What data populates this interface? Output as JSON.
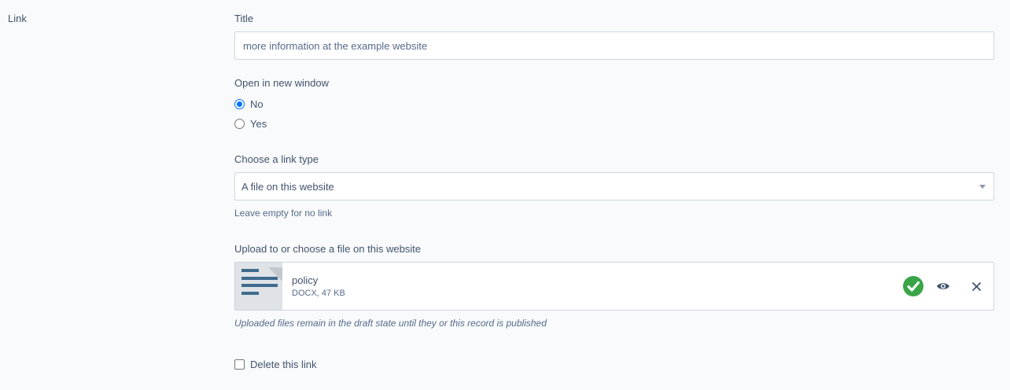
{
  "section": {
    "label": "Link"
  },
  "title_field": {
    "label": "Title",
    "value": "more information at the example website"
  },
  "new_window": {
    "label": "Open in new window",
    "options": [
      {
        "label": "No",
        "checked": true
      },
      {
        "label": "Yes",
        "checked": false
      }
    ]
  },
  "link_type": {
    "label": "Choose a link type",
    "selected": "A file on this website",
    "help": "Leave empty for no link"
  },
  "upload": {
    "label": "Upload to or choose a file on this website",
    "file": {
      "name": "policy",
      "meta": "DOCX, 47 KB",
      "icon": "document-icon"
    },
    "icons": [
      "check-circle-icon",
      "eye-icon",
      "close-icon"
    ],
    "help": "Uploaded files remain in the draft state until they or this record is published"
  },
  "delete_link": {
    "label": "Delete this link",
    "checked": false
  },
  "colors": {
    "success": "#3aa547",
    "radio_accent": "#0075ff",
    "doc_lines": "#3f6a8f"
  }
}
